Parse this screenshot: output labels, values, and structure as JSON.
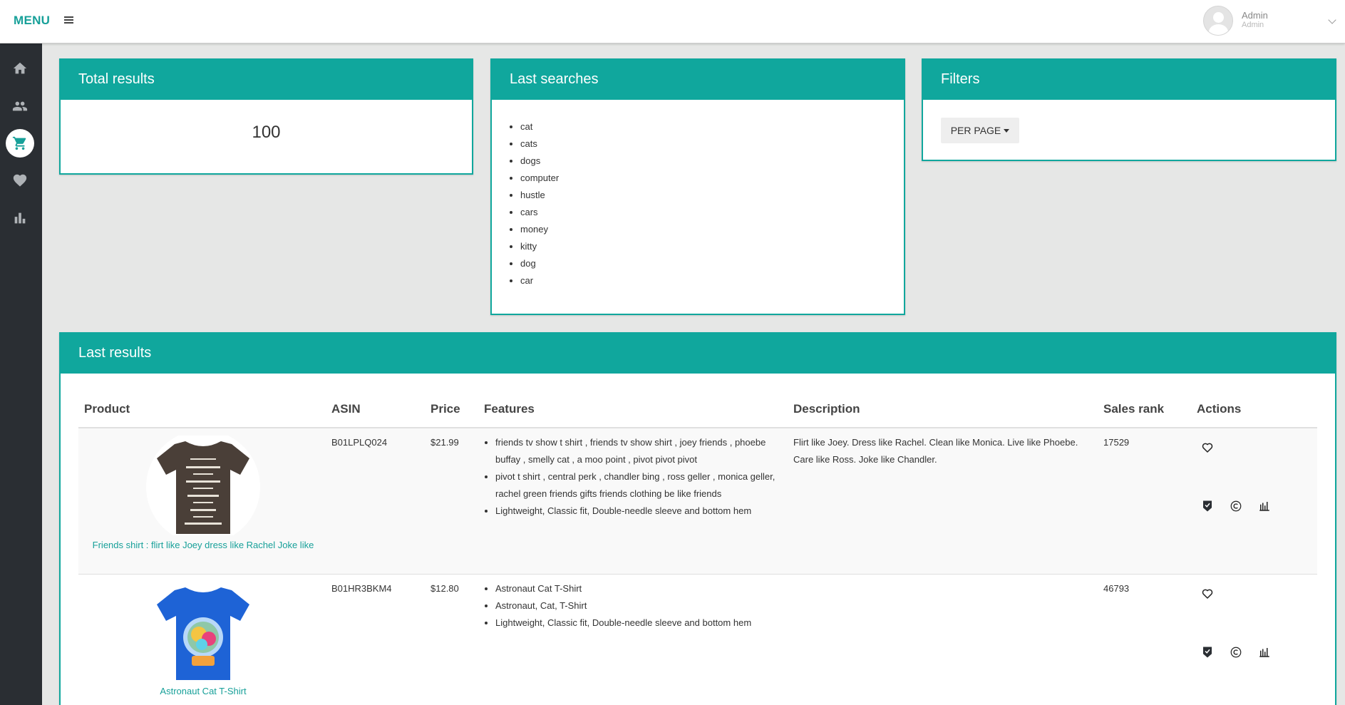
{
  "topbar": {
    "menu_label": "MENU",
    "user_name": "Admin",
    "user_role": "Admin"
  },
  "sidebar": {
    "items": [
      {
        "icon": "home-icon",
        "active": false
      },
      {
        "icon": "users-icon",
        "active": false
      },
      {
        "icon": "cart-icon",
        "active": true
      },
      {
        "icon": "heart-icon",
        "active": false
      },
      {
        "icon": "bar-chart-icon",
        "active": false
      }
    ]
  },
  "total_results": {
    "title": "Total results",
    "value": "100"
  },
  "last_searches": {
    "title": "Last searches",
    "items": [
      "cat",
      "cats",
      "dogs",
      "computer",
      "hustle",
      "cars",
      "money",
      "kitty",
      "dog",
      "car"
    ]
  },
  "filters": {
    "title": "Filters",
    "per_page_label": "PER PAGE"
  },
  "last_results": {
    "title": "Last results",
    "columns": [
      "Product",
      "ASIN",
      "Price",
      "Features",
      "Description",
      "Sales rank",
      "Actions"
    ],
    "rows": [
      {
        "product": "Friends shirt : flirt like Joey dress like Rachel Joke like",
        "shirt_color": "#4a3f38",
        "asin": "B01LPLQ024",
        "price": "$21.99",
        "features": [
          "friends tv show t shirt , friends tv show shirt , joey friends , phoebe buffay , smelly cat , a moo point , pivot pivot pivot",
          "pivot t shirt , central perk , chandler bing , ross geller , monica geller, rachel green friends gifts friends clothing be like friends",
          "Lightweight, Classic fit, Double-needle sleeve and bottom hem"
        ],
        "description": "Flirt like Joey. Dress like Rachel. Clean like Monica. Live like Phoebe. Care like Ross. Joke like Chandler.",
        "sales_rank": "17529"
      },
      {
        "product": "Astronaut Cat T-Shirt",
        "shirt_color": "#1e63d6",
        "asin": "B01HR3BKM4",
        "price": "$12.80",
        "features": [
          "Astronaut Cat T-Shirt",
          "Astronaut, Cat, T-Shirt",
          "Lightweight, Classic fit, Double-needle sleeve and bottom hem"
        ],
        "description": "",
        "sales_rank": "46793"
      }
    ]
  },
  "colors": {
    "accent": "#10a79d",
    "link": "#17a099",
    "sidebar": "#2a2e33",
    "background": "#e6e7e6"
  }
}
